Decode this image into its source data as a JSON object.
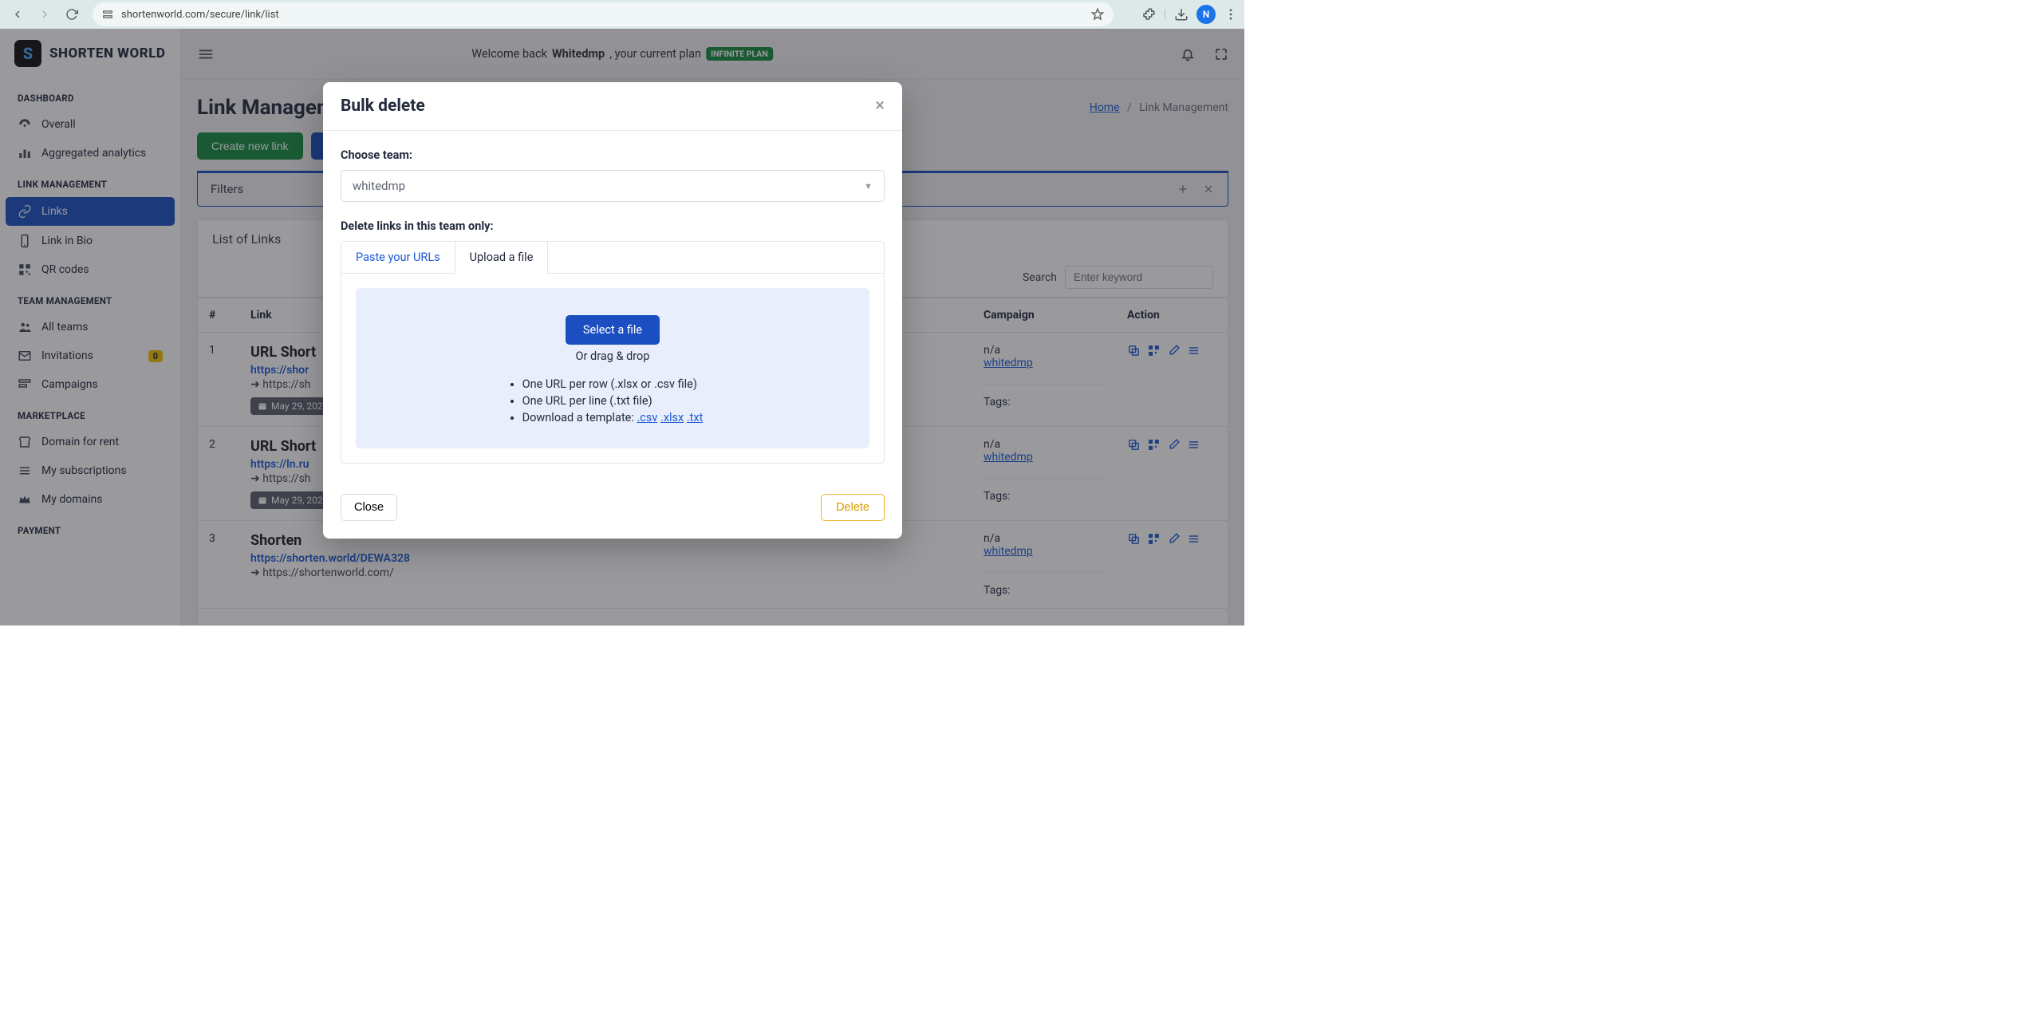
{
  "browser": {
    "url": "shortenworld.com/secure/link/list",
    "avatar_initial": "N"
  },
  "brand": {
    "name_text": "SHORTEN WORLD"
  },
  "sidebar": {
    "sections": {
      "dashboard": {
        "title": "DASHBOARD",
        "overall": "Overall",
        "aggregated": "Aggregated analytics"
      },
      "link_mgmt": {
        "title": "LINK MANAGEMENT",
        "links": "Links",
        "link_bio": "Link in Bio",
        "qr": "QR codes"
      },
      "team_mgmt": {
        "title": "TEAM MANAGEMENT",
        "all_teams": "All teams",
        "invitations": "Invitations",
        "inv_badge": "0",
        "campaigns": "Campaigns"
      },
      "marketplace": {
        "title": "MARKETPLACE",
        "domain_rent": "Domain for rent",
        "subs": "My subscriptions",
        "domains": "My domains"
      },
      "payment": {
        "title": "PAYMENT"
      }
    }
  },
  "topbar": {
    "welcome_pre": "Welcome back ",
    "welcome_user": "Whitedmp",
    "welcome_post": ", your current plan ",
    "plan": "INFINITE PLAN"
  },
  "page": {
    "title": "Link Management",
    "bc_home": "Home",
    "bc_current": "Link Management",
    "btn_create": "Create new link",
    "filters_label": "Filters",
    "list_title": "List of Links",
    "search_label": "Search",
    "search_placeholder": "Enter keyword"
  },
  "table": {
    "col_num": "#",
    "col_link": "Link",
    "col_campaign": "Campaign",
    "col_action": "Action",
    "rows": [
      {
        "n": "1",
        "title": "URL Short",
        "short": "https://shor",
        "orig": "https://sh",
        "date": "May 29, 202",
        "camp": "n/a",
        "team": "whitedmp",
        "tags": "Tags:"
      },
      {
        "n": "2",
        "title": "URL Short",
        "short": "https://ln.ru",
        "orig": "https://sh",
        "date": "May 29, 202",
        "camp": "n/a",
        "team": "whitedmp",
        "tags": "Tags:"
      },
      {
        "n": "3",
        "title": "Shorten",
        "short": "https://shorten.world/DEWA328",
        "orig": "https://shortenworld.com/",
        "date": "",
        "camp": "n/a",
        "team": "whitedmp",
        "tags": "Tags:"
      }
    ]
  },
  "modal": {
    "title": "Bulk delete",
    "label_team": "Choose team:",
    "team_value": "whitedmp",
    "label_delete_in": "Delete links in this team only:",
    "tab_paste": "Paste your URLs",
    "tab_upload": "Upload a file",
    "btn_select_file": "Select a file",
    "drag_text": "Or drag & drop",
    "hint1": "One URL per row (.xlsx or .csv file)",
    "hint2": "One URL per line (.txt file)",
    "hint3_pre": "Download a template: ",
    "hint3_csv": ".csv",
    "hint3_xlsx": ".xlsx",
    "hint3_txt": ".txt",
    "btn_close": "Close",
    "btn_delete": "Delete"
  }
}
